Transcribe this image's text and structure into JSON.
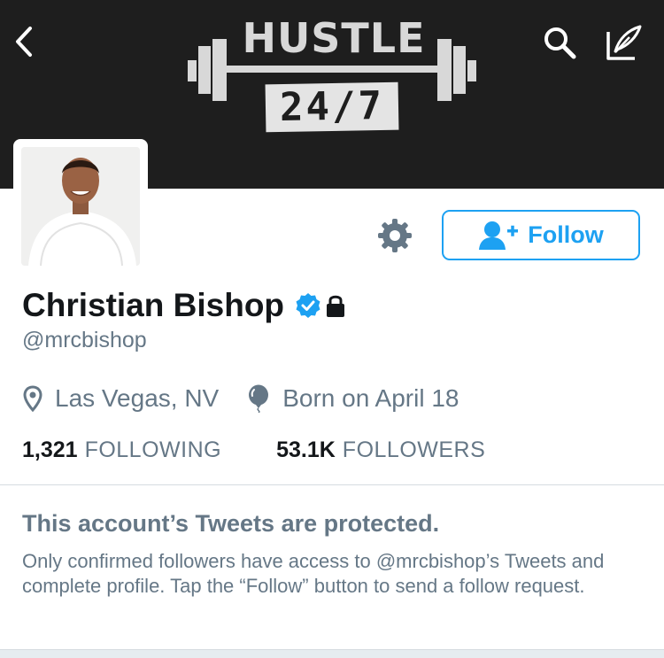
{
  "banner": {
    "logo_word": "HUSTLE",
    "logo_number": "24/7"
  },
  "icons": {
    "back": "chevron-left-icon",
    "search": "search-icon",
    "compose": "compose-icon",
    "settings": "gear-icon",
    "follow": "add-user-icon",
    "verified": "verified-badge-icon",
    "lock": "lock-icon",
    "location": "location-pin-icon",
    "birthday": "balloon-icon"
  },
  "colors": {
    "accent": "#1da1f2",
    "header_bg": "#1e1e1e",
    "secondary_text": "#657786"
  },
  "profile": {
    "display_name": "Christian Bishop",
    "handle": "@mrcbishop",
    "location": "Las Vegas, NV",
    "birthday": "Born on April 18"
  },
  "actions": {
    "follow_label": "Follow"
  },
  "stats": {
    "following_count": "1,321",
    "following_label": "FOLLOWING",
    "followers_count": "53.1K",
    "followers_label": "FOLLOWERS"
  },
  "protected": {
    "title": "This account’s Tweets are protected.",
    "body": "Only confirmed followers have access to @mrcbishop’s Tweets and complete profile. Tap the “Follow” button to send a follow request."
  }
}
